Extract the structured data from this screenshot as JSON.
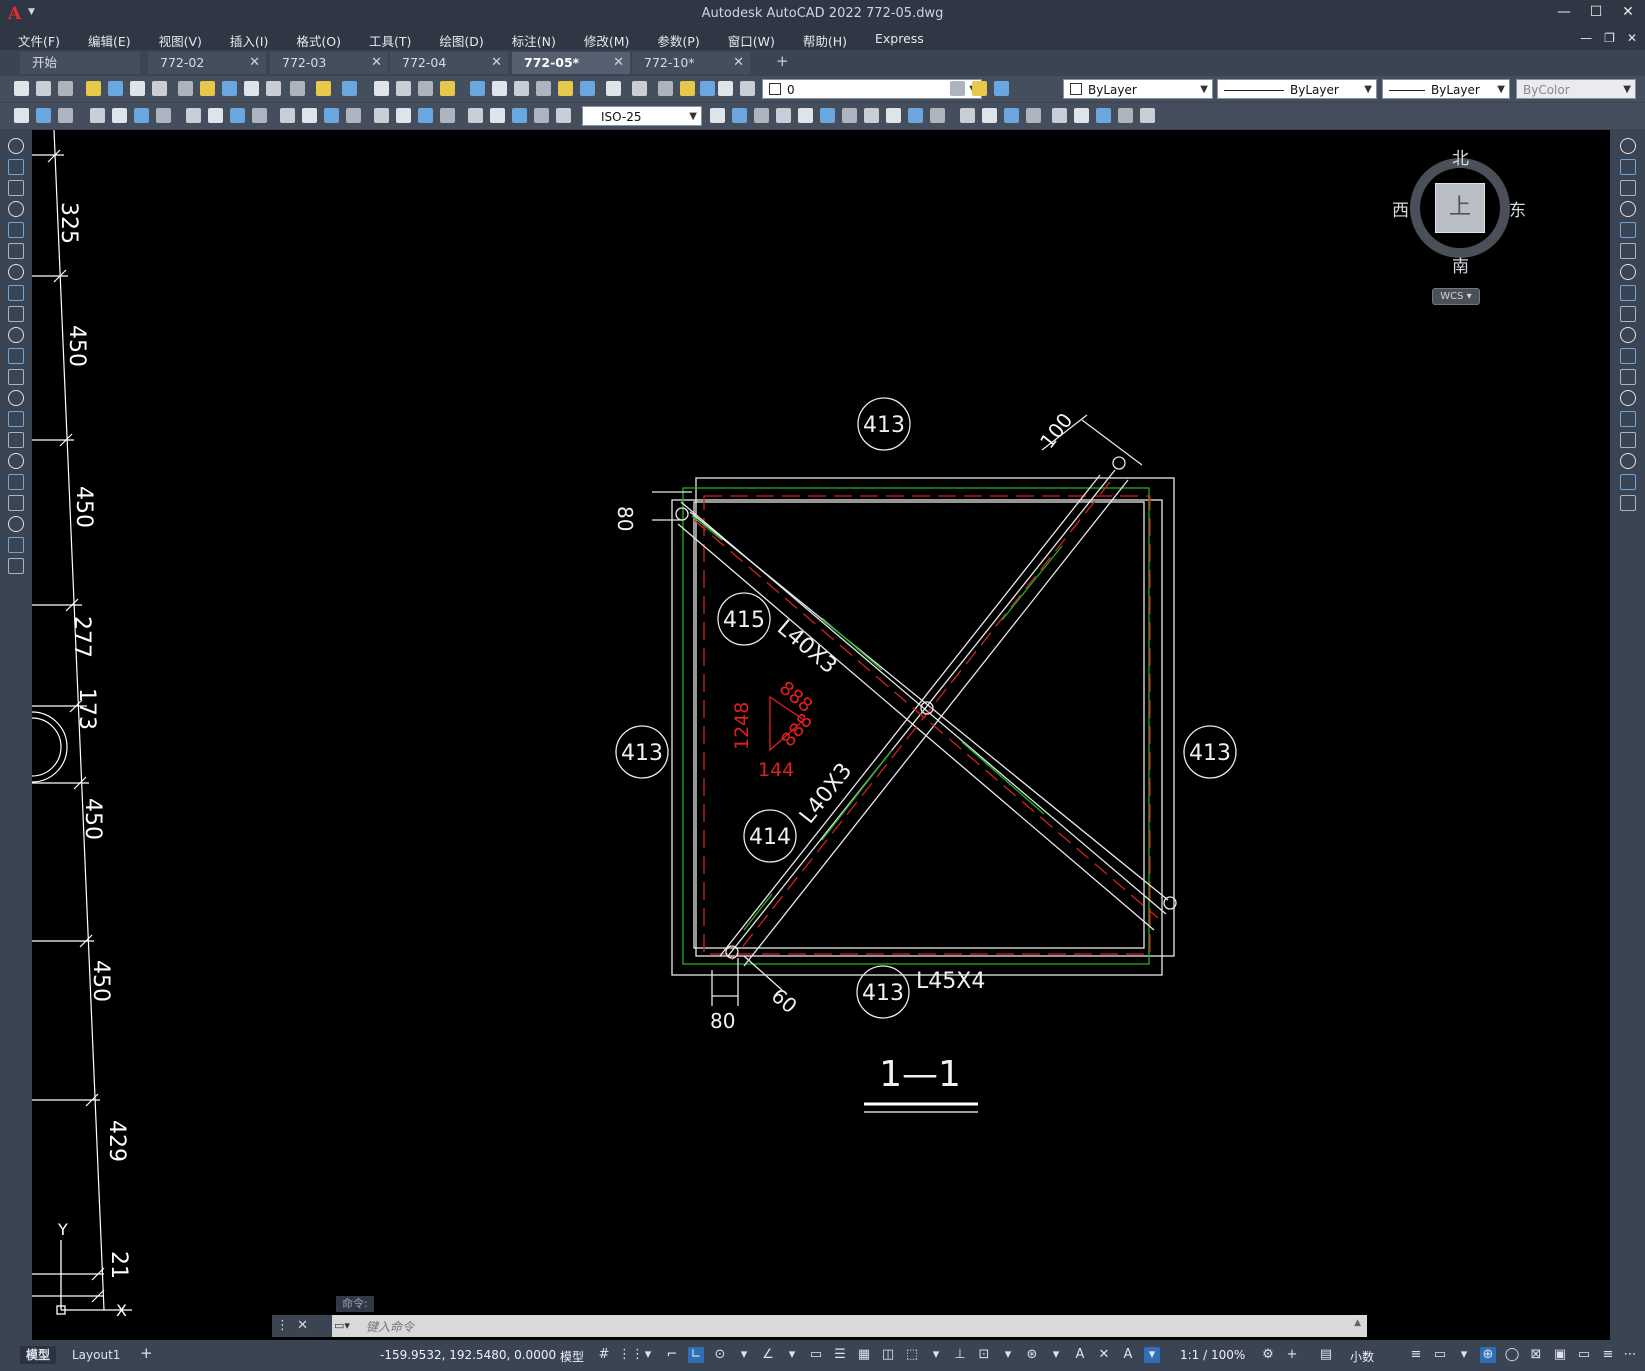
{
  "window": {
    "title": "Autodesk AutoCAD 2022    772-05.dwg",
    "logo": "A"
  },
  "menu": [
    "文件(F)",
    "编辑(E)",
    "视图(V)",
    "插入(I)",
    "格式(O)",
    "工具(T)",
    "绘图(D)",
    "标注(N)",
    "修改(M)",
    "参数(P)",
    "窗口(W)",
    "帮助(H)",
    "Express"
  ],
  "tabs": [
    {
      "label": "开始",
      "active": false,
      "closable": false
    },
    {
      "label": "772-02",
      "active": false,
      "closable": true
    },
    {
      "label": "772-03",
      "active": false,
      "closable": true
    },
    {
      "label": "772-04",
      "active": false,
      "closable": true
    },
    {
      "label": "772-05*",
      "active": true,
      "closable": true
    },
    {
      "label": "772-10*",
      "active": false,
      "closable": true
    }
  ],
  "toolbar": {
    "layer_value": "0",
    "color_value": "ByLayer",
    "linetype_value": "ByLayer",
    "lineweight_value": "ByLayer",
    "plotstyle_value": "ByColor",
    "dimstyle_value": "ISO-25"
  },
  "viewcube": {
    "north": "北",
    "south": "南",
    "east": "东",
    "west": "西",
    "face": "上",
    "wcs": "WCS"
  },
  "drawing": {
    "left_dims": [
      "325",
      "450",
      "450",
      "277",
      "173",
      "450",
      "450",
      "429",
      "21"
    ],
    "ucs_y": "Y",
    "ucs_x": "X",
    "callouts": {
      "top": "413",
      "left": "413",
      "right": "413",
      "bottom": "413",
      "brace_a": "415",
      "brace_b": "414"
    },
    "labels": {
      "brace_a": "L40X3",
      "brace_b": "L40X3",
      "bottom_member": "L45X4",
      "dim_100": "100",
      "dim_80_left": "80",
      "dim_80_bottom": "80",
      "dim_60": "60"
    },
    "weld": {
      "v": "1248",
      "b": "144",
      "a": "888",
      "c": "888"
    },
    "section_title": "1—1"
  },
  "command": {
    "history": "命令:",
    "placeholder": "键入命令"
  },
  "status": {
    "layout_tabs": [
      {
        "label": "模型",
        "active": true
      },
      {
        "label": "Layout1",
        "active": false
      }
    ],
    "coordinates": "-159.9532, 192.5480, 0.0000",
    "space": "模型",
    "scale": "1:1 / 100%",
    "units": "小数"
  }
}
